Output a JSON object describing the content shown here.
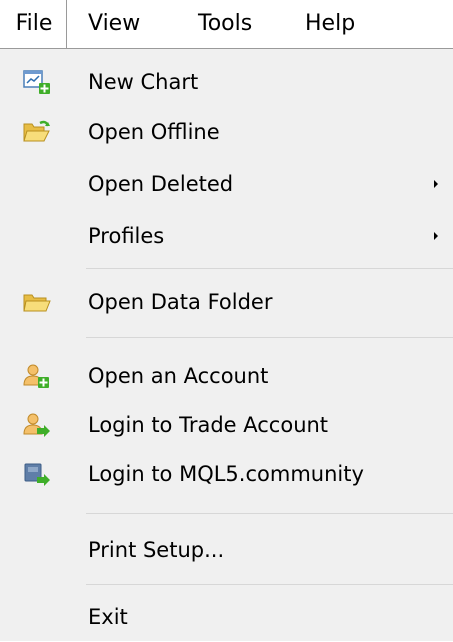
{
  "menubar": {
    "items": [
      {
        "label": "File",
        "active": true
      },
      {
        "label": "View"
      },
      {
        "label": "Tools"
      },
      {
        "label": "Help"
      }
    ]
  },
  "file_menu": {
    "items": [
      {
        "label": "New Chart",
        "icon": "new-chart-icon"
      },
      {
        "label": "Open Offline",
        "icon": "open-folder-icon"
      },
      {
        "label": "Open Deleted",
        "submenu": true
      },
      {
        "label": "Profiles",
        "submenu": true
      },
      {
        "label": "Open Data Folder",
        "icon": "folder-icon"
      },
      {
        "label": "Open an Account",
        "icon": "user-add-icon"
      },
      {
        "label": "Login to Trade Account",
        "icon": "user-login-icon"
      },
      {
        "label": "Login to MQL5.community",
        "icon": "mql5-login-icon"
      },
      {
        "label": "Print Setup..."
      },
      {
        "label": "Exit"
      }
    ]
  },
  "colors": {
    "menu_background": "#f0f0f0",
    "separator": "#d7d7d7",
    "folder_yellow": "#f2d26a",
    "plus_green": "#3fae29"
  }
}
